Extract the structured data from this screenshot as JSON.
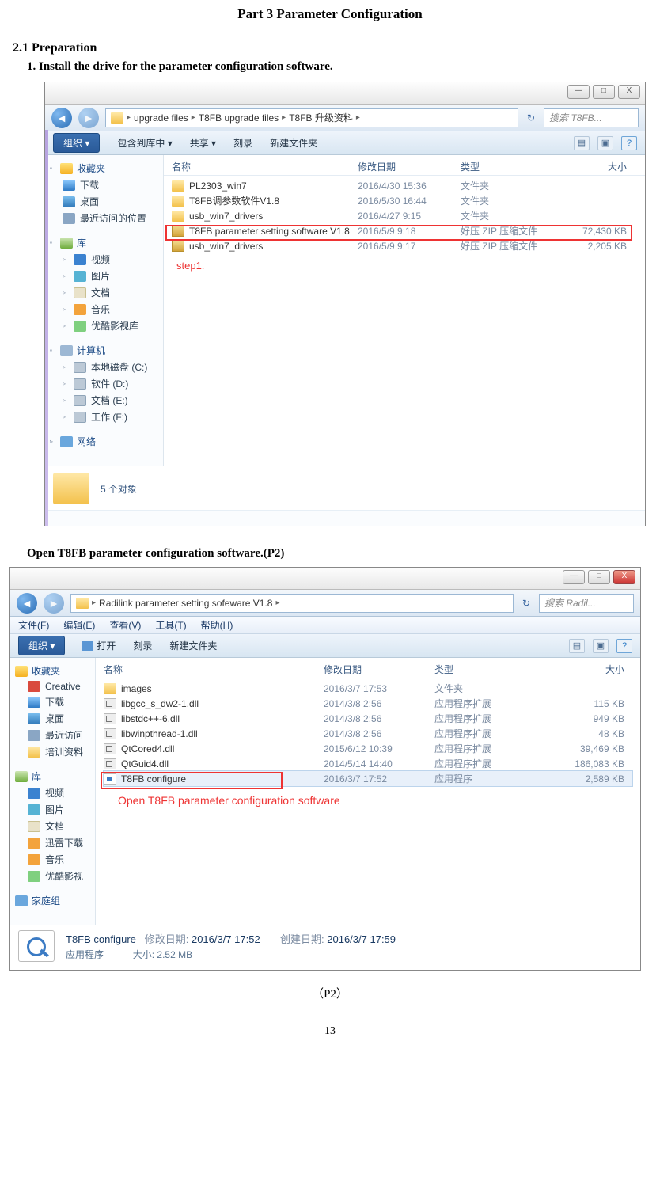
{
  "doc": {
    "part_title": "Part 3    Parameter Configuration",
    "section": "2.1 Preparation",
    "step1": "1. Install the drive for the parameter configuration software.",
    "caption2": "Open T8FB parameter configuration software.(P2)",
    "figcap": "（P2）",
    "pagenum": "13"
  },
  "win_controls": {
    "min": "—",
    "max": "□",
    "close": "X"
  },
  "explorer1": {
    "breadcrumb": [
      "upgrade files",
      "T8FB upgrade files",
      "T8FB 升级资料"
    ],
    "search_placeholder": "搜索 T8FB...",
    "toolbar": {
      "org": "组织 ▾",
      "include": "包含到库中 ▾",
      "share": "共享 ▾",
      "burn": "刻录",
      "newfolder": "新建文件夹"
    },
    "columns": {
      "name": "名称",
      "date": "修改日期",
      "type": "类型",
      "size": "大小"
    },
    "sidebar": {
      "fav": "收藏夹",
      "fav_items": [
        [
          "下载",
          "dl"
        ],
        [
          "桌面",
          "desk"
        ],
        [
          "最近访问的位置",
          "rec"
        ]
      ],
      "lib": "库",
      "lib_items": [
        [
          "视频",
          "vid"
        ],
        [
          "图片",
          "img"
        ],
        [
          "文档",
          "doc"
        ],
        [
          "音乐",
          "mus"
        ],
        [
          "优酷影视库",
          "yk"
        ]
      ],
      "pc": "计算机",
      "pc_items": [
        [
          "本地磁盘 (C:)",
          "drv"
        ],
        [
          "软件 (D:)",
          "drv"
        ],
        [
          "文档 (E:)",
          "drv"
        ],
        [
          "工作 (F:)",
          "drv"
        ]
      ],
      "net": "网络"
    },
    "rows": [
      {
        "icon": "folder",
        "name": "PL2303_win7",
        "date": "2016/4/30 15:36",
        "type": "文件夹",
        "size": ""
      },
      {
        "icon": "folder",
        "name": "T8FB调参数软件V1.8",
        "date": "2016/5/30 16:44",
        "type": "文件夹",
        "size": ""
      },
      {
        "icon": "folder",
        "name": "usb_win7_drivers",
        "date": "2016/4/27 9:15",
        "type": "文件夹",
        "size": ""
      },
      {
        "icon": "zip",
        "name": "T8FB parameter setting software V1.8",
        "date": "2016/5/9 9:18",
        "type": "好压 ZIP 压缩文件",
        "size": "72,430 KB"
      },
      {
        "icon": "zip",
        "name": "usb_win7_drivers",
        "date": "2016/5/9 9:17",
        "type": "好压 ZIP 压缩文件",
        "size": "2,205 KB"
      }
    ],
    "step_note": "step1.",
    "status": "5 个对象"
  },
  "explorer2": {
    "breadcrumb": [
      "Radilink parameter setting sofeware V1.8"
    ],
    "search_placeholder": "搜索 Radil...",
    "menubar": [
      "文件(F)",
      "编辑(E)",
      "查看(V)",
      "工具(T)",
      "帮助(H)"
    ],
    "toolbar": {
      "org": "组织 ▾",
      "open": "打开",
      "burn": "刻录",
      "newfolder": "新建文件夹"
    },
    "columns": {
      "name": "名称",
      "date": "修改日期",
      "type": "类型",
      "size": "大小"
    },
    "sidebar": {
      "fav": "收藏夹",
      "fav_items": [
        [
          "Creative",
          "cc"
        ],
        [
          "下载",
          "dl"
        ],
        [
          "桌面",
          "desk"
        ],
        [
          "最近访问",
          "rec"
        ],
        [
          "培训资料",
          "fold"
        ]
      ],
      "lib": "库",
      "lib_items": [
        [
          "视频",
          "vid"
        ],
        [
          "图片",
          "img"
        ],
        [
          "文档",
          "doc"
        ],
        [
          "迅雷下载",
          "xl"
        ],
        [
          "音乐",
          "mus"
        ],
        [
          "优酷影视",
          "yk"
        ]
      ],
      "home": "家庭组"
    },
    "rows": [
      {
        "icon": "folder",
        "name": "images",
        "date": "2016/3/7 17:53",
        "type": "文件夹",
        "size": ""
      },
      {
        "icon": "dll",
        "name": "libgcc_s_dw2-1.dll",
        "date": "2014/3/8 2:56",
        "type": "应用程序扩展",
        "size": "115 KB"
      },
      {
        "icon": "dll",
        "name": "libstdc++-6.dll",
        "date": "2014/3/8 2:56",
        "type": "应用程序扩展",
        "size": "949 KB"
      },
      {
        "icon": "dll",
        "name": "libwinpthread-1.dll",
        "date": "2014/3/8 2:56",
        "type": "应用程序扩展",
        "size": "48 KB"
      },
      {
        "icon": "dll",
        "name": "QtCored4.dll",
        "date": "2015/6/12 10:39",
        "type": "应用程序扩展",
        "size": "39,469 KB"
      },
      {
        "icon": "dll",
        "name": "QtGuid4.dll",
        "date": "2014/5/14 14:40",
        "type": "应用程序扩展",
        "size": "186,083 KB"
      },
      {
        "icon": "exe",
        "name": "T8FB configure",
        "date": "2016/3/7 17:52",
        "type": "应用程序",
        "size": "2,589 KB",
        "sel": true
      }
    ],
    "annotation": "Open T8FB parameter configuration software",
    "details": {
      "name": "T8FB configure",
      "k_mod": "修改日期:",
      "v_mod": "2016/3/7 17:52",
      "k_create": "创建日期:",
      "v_create": "2016/3/7 17:59",
      "type": "应用程序",
      "k_size": "大小:",
      "v_size": "2.52 MB"
    }
  }
}
